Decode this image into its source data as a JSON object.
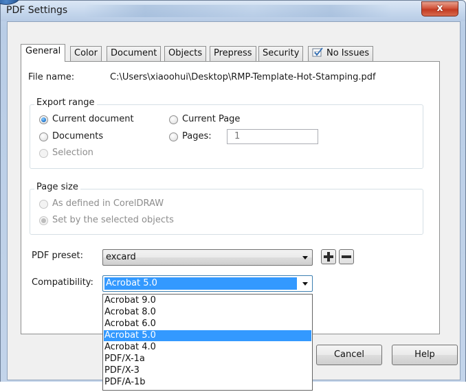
{
  "window": {
    "title": "PDF Settings",
    "close_glyph": "x"
  },
  "tabs": [
    {
      "label": "General",
      "active": true
    },
    {
      "label": "Color",
      "active": false
    },
    {
      "label": "Document",
      "active": false
    },
    {
      "label": "Objects",
      "active": false
    },
    {
      "label": "Prepress",
      "active": false
    },
    {
      "label": "Security",
      "active": false
    },
    {
      "label": "No Issues",
      "active": false,
      "icon": "checklist-icon"
    }
  ],
  "general": {
    "file_name_label": "File name:",
    "file_name_value": "C:\\Users\\xiaoohui\\Desktop\\RMP-Template-Hot-Stamping.pdf",
    "export_range": {
      "legend": "Export range",
      "current_document": "Current document",
      "current_page": "Current Page",
      "documents": "Documents",
      "pages": "Pages:",
      "pages_value": "1",
      "selection": "Selection",
      "selected": "current_document"
    },
    "page_size": {
      "legend": "Page size",
      "as_defined": "As defined in CorelDRAW",
      "set_by_selected": "Set by the selected objects",
      "selected": "set_by_selected"
    },
    "pdf_preset_label": "PDF preset:",
    "pdf_preset_value": "excard",
    "compatibility_label": "Compatibility:",
    "compatibility_value": "Acrobat 5.0",
    "compatibility_options": [
      "Acrobat 9.0",
      "Acrobat 8.0",
      "Acrobat 6.0",
      "Acrobat 5.0",
      "Acrobat 4.0",
      "PDF/X-1a",
      "PDF/X-3",
      "PDF/A-1b"
    ],
    "compatibility_selected_index": 3
  },
  "buttons": {
    "cancel": "Cancel",
    "help": "Help"
  },
  "colors": {
    "selection_blue": "#3399ff",
    "close_red": "#c23b22"
  }
}
